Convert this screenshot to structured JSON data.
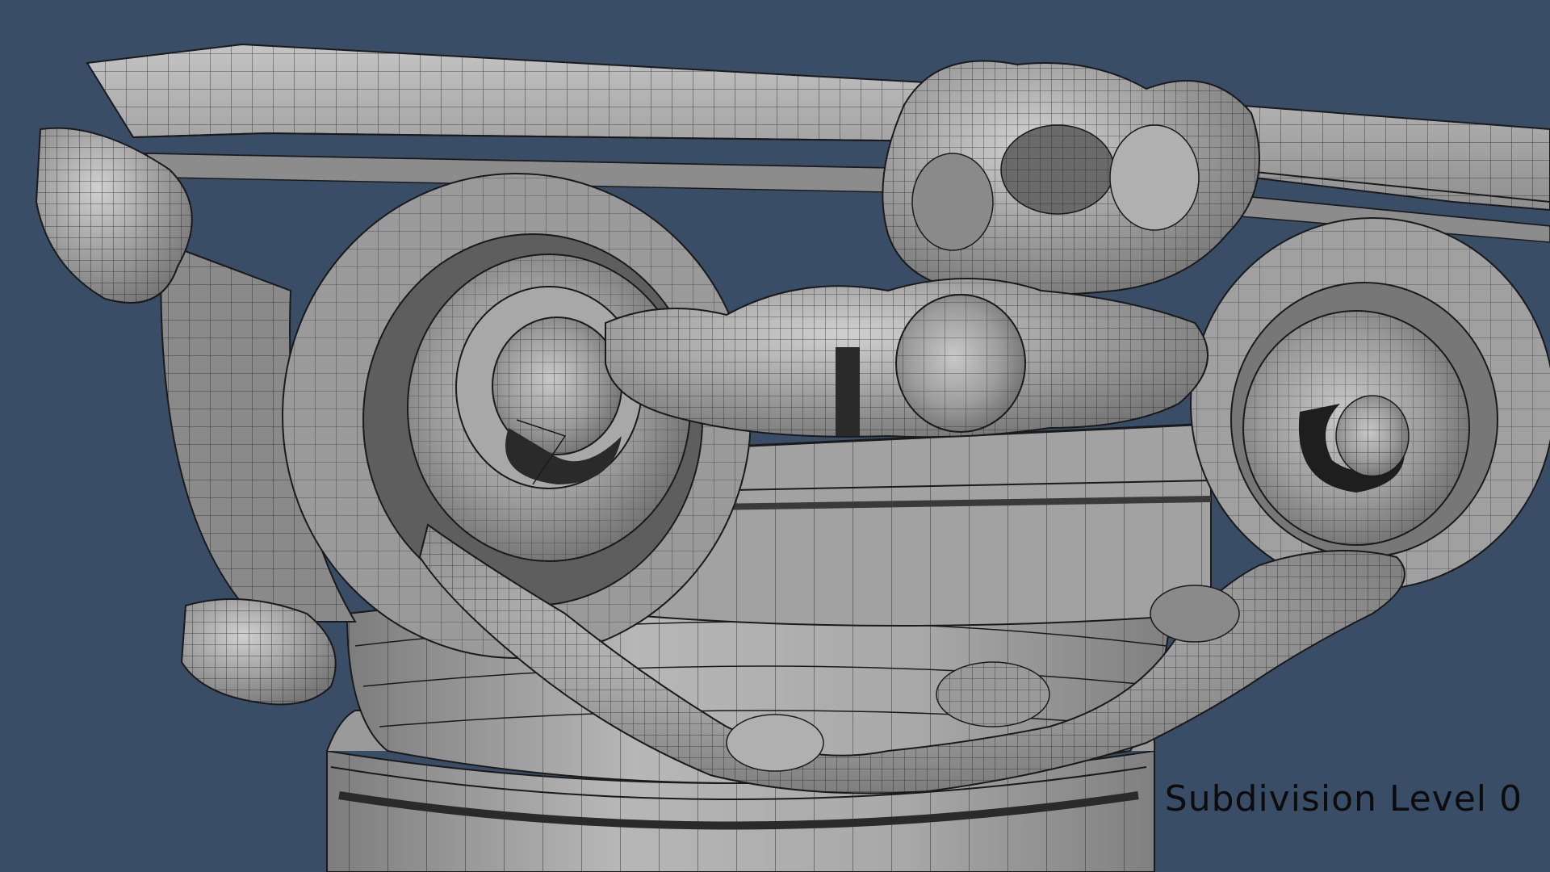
{
  "viewport": {
    "background_color": "#3a4d66",
    "model_color": "#a6a6a6",
    "wire_color": "#1a1a1a"
  },
  "overlay": {
    "label": "Subdivision Level 0"
  }
}
